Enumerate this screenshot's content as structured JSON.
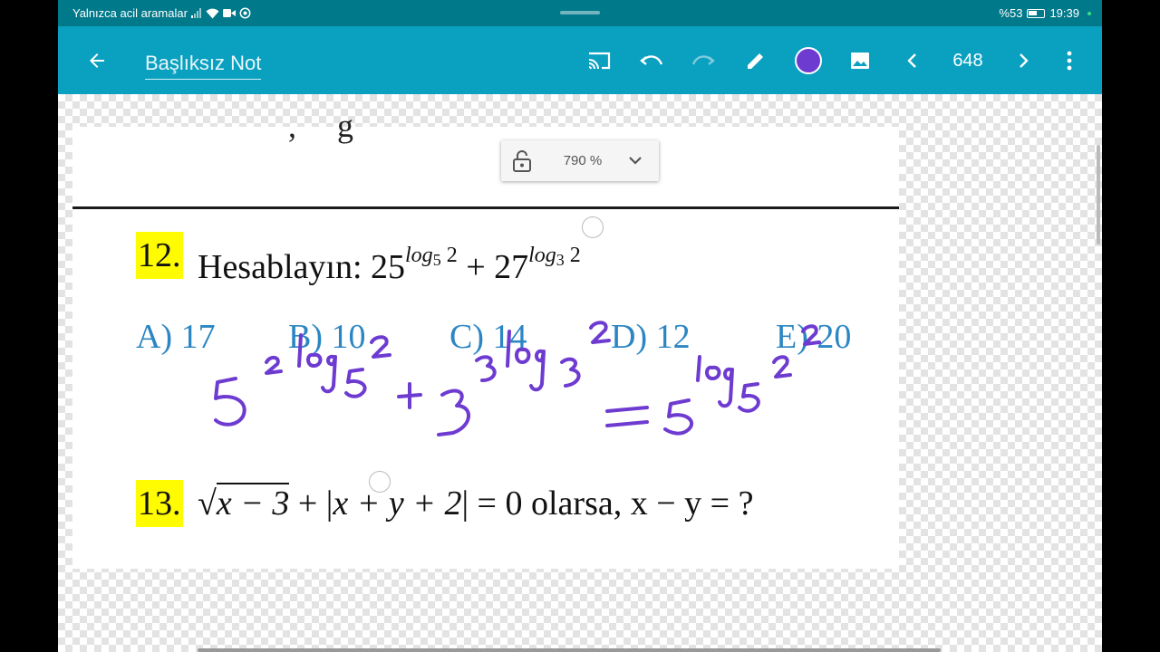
{
  "status": {
    "carrier_text": "Yalnızca acil aramalar",
    "battery": "%53",
    "time": "19:39"
  },
  "appbar": {
    "title": "Başlıksız Not",
    "page_number": "648",
    "pen_color": "#6e3bd1",
    "icons": [
      "back-arrow-icon",
      "cast-icon",
      "undo-icon",
      "redo-icon",
      "pen-icon",
      "color-picker",
      "image-icon",
      "chevron-left-icon",
      "chevron-right-icon",
      "more-vert-icon"
    ]
  },
  "zoom": {
    "value": "790 %"
  },
  "document": {
    "q12": {
      "number": "12.",
      "prefix": "Hesablayın: 25",
      "exp1_log": "log",
      "exp1_base": "5",
      "exp1_arg": " 2",
      "plus": " + 27",
      "exp2_log": "log",
      "exp2_base": "3",
      "exp2_arg": " 2",
      "choices": [
        "A) 17",
        "B) 10",
        "C) 14",
        "D) 12",
        "E) 20"
      ]
    },
    "q13": {
      "number": "13.",
      "sqrt_sign": "√",
      "radicand": "x − 3",
      "abs_open": " + |",
      "abs_inner": "x + y + 2",
      "rest": "| = 0 olarsa, x − y = ?"
    }
  }
}
